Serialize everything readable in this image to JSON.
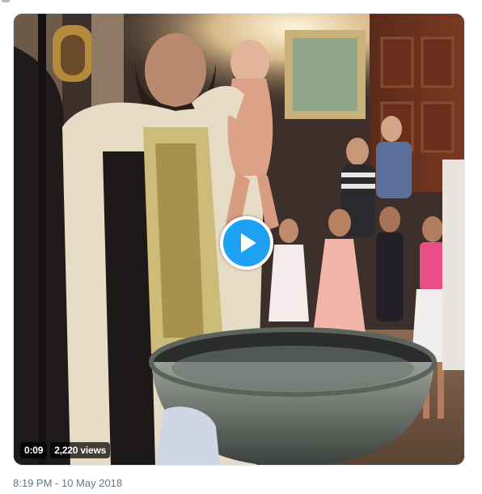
{
  "video": {
    "duration": "0:09",
    "views": "2,220 views",
    "play_icon": "play-icon"
  },
  "tweet": {
    "time": "8:19 PM",
    "separator": " - ",
    "date": "10 May 2018"
  },
  "colors": {
    "accent": "#1da1f2",
    "meta_text": "#657786",
    "card_border": "#e1e8ed"
  }
}
